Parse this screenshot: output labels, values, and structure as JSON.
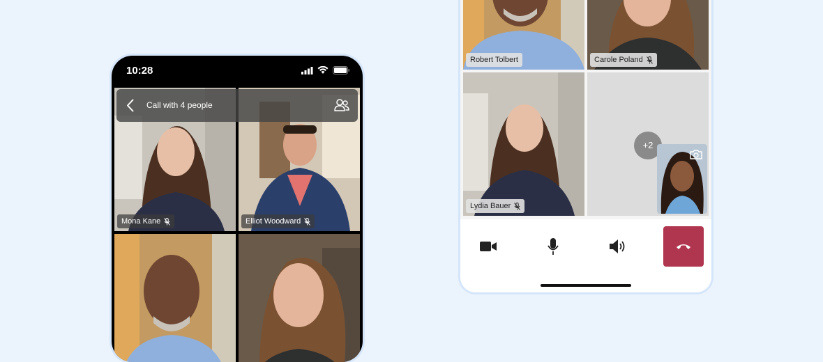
{
  "left_phone": {
    "status": {
      "time": "10:28"
    },
    "call_bar": {
      "title": "Call with 4 people"
    },
    "participants": [
      {
        "name": "Mona Kane"
      },
      {
        "name": "Elliot Woodward"
      },
      {
        "name": "Robert Tolbert"
      },
      {
        "name": "Carole Poland"
      }
    ]
  },
  "right_phone": {
    "participants": [
      {
        "name": "Robert Tolbert"
      },
      {
        "name": "Carole Poland"
      },
      {
        "name": "Lydia Bauer"
      }
    ],
    "more_count": "+2",
    "controls": {
      "video": "video-camera-icon",
      "mic": "microphone-icon",
      "speaker": "speaker-icon",
      "end": "hang-up-icon"
    },
    "end_call_color": "#b0364f",
    "active_speaker_border": "#1a78d6"
  }
}
